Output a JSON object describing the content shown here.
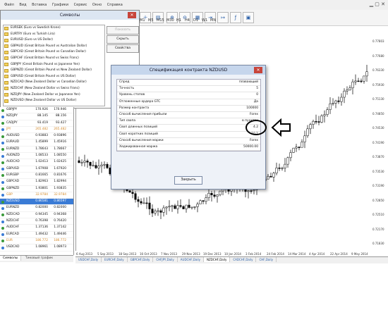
{
  "menubar": {
    "items": [
      "Файл",
      "Вид",
      "Вставка",
      "Графики",
      "Сервис",
      "Окно",
      "Справка"
    ]
  },
  "toolbar": {
    "timeframes": [
      "M1",
      "M5",
      "M15",
      "M30",
      "H1",
      "H4",
      "D1",
      "W1",
      "MN"
    ]
  },
  "symbols_window": {
    "title": "Символы",
    "items": [
      "EURSEK (Euro vs Swedish Krone)",
      "EURTRY (Euro vs Turkish Lira)",
      "EURUSD (Euro vs US Dollar)",
      "GBPAUD (Great Britain Pound vs Australian Dollar)",
      "GBPCAD (Great Britain Pound vs Canadian Dollar)",
      "GBPCHF (Great Britain Pound vs Swiss Franc)",
      "GBPJPY (Great Britain Pound vs Japanese Yen)",
      "GBPNZD (Great Britain Pound vs New Zealand Dollar)",
      "GBPUSD (Great Britain Pound vs US Dollar)",
      "NZDCAD (New Zealand Dollar vs Canadian Dollar)",
      "NZDCHF (New Zealand Dollar vs Swiss Franc)",
      "NZDJPY (New Zealand Dollar vs Japanese Yen)",
      "NZDUSD (New Zealand Dollar vs US Dollar)"
    ],
    "buttons": {
      "show": "Показать",
      "hide": "Скрыть",
      "properties": "Свойства"
    }
  },
  "market_watch": {
    "rows": [
      {
        "symbol": "GBPJPY",
        "bid": "170.926",
        "ask": "170.946",
        "style": "normal"
      },
      {
        "symbol": "NZDJPY",
        "bid": "88.145",
        "ask": "88.156",
        "style": "normal"
      },
      {
        "symbol": "CADJPY",
        "bid": "93.419",
        "ask": "93.427",
        "style": "normal"
      },
      {
        "symbol": "JPY",
        "bid": "265.482",
        "ask": "265.482",
        "style": "faded"
      },
      {
        "symbol": "AUDUSD",
        "bid": "0.93883",
        "ask": "0.93896",
        "style": "normal"
      },
      {
        "symbol": "EURAUD",
        "bid": "1.45899",
        "ask": "1.45916",
        "style": "normal"
      },
      {
        "symbol": "EURNZD",
        "bid": "1.78643",
        "ask": "1.78667",
        "style": "normal"
      },
      {
        "symbol": "AUDNZD",
        "bid": "1.08533",
        "ask": "1.08550",
        "style": "normal"
      },
      {
        "symbol": "AUDCAD",
        "bid": "1.02413",
        "ask": "1.02425",
        "style": "normal"
      },
      {
        "symbol": "GBPUSD",
        "bid": "1.67908",
        "ask": "1.67920",
        "style": "normal"
      },
      {
        "symbol": "EURGBP",
        "bid": "0.81665",
        "ask": "0.81676",
        "style": "normal"
      },
      {
        "symbol": "GBPCAD",
        "bid": "1.82963",
        "ask": "1.82994",
        "style": "normal"
      },
      {
        "symbol": "GBPNZD",
        "bid": "1.93801",
        "ask": "1.93835",
        "style": "normal"
      },
      {
        "symbol": "GBP",
        "bid": "32.9784",
        "ask": "32.9784",
        "style": "faded"
      },
      {
        "symbol": "NZDUSD",
        "bid": "0.86581",
        "ask": "0.86597",
        "style": "selected"
      },
      {
        "symbol": "EURNZD",
        "bid": "0.82000",
        "ask": "0.82000",
        "style": "normal"
      },
      {
        "symbol": "NZDCAD",
        "bid": "0.94345",
        "ask": "0.94368",
        "style": "normal"
      },
      {
        "symbol": "NZDCHF",
        "bid": "0.76398",
        "ask": "0.76420",
        "style": "normal"
      },
      {
        "symbol": "AUDCHF",
        "bid": "1.37136",
        "ask": "1.37142",
        "style": "normal"
      },
      {
        "symbol": "EURCAD",
        "bid": "1.49432",
        "ask": "1.49446",
        "style": "normal"
      },
      {
        "symbol": "EUR",
        "bid": "186.772",
        "ask": "186.772",
        "style": "faded"
      },
      {
        "symbol": "USDCAD",
        "bid": "1.08961",
        "ask": "1.08973",
        "style": "normal"
      }
    ],
    "tabs": [
      "Символы",
      "Тиковый график"
    ]
  },
  "modal": {
    "title": "Спецификация контракта NZDUSD",
    "rows": [
      {
        "key": "Спред",
        "value": "плавающий"
      },
      {
        "key": "Точность",
        "value": "5"
      },
      {
        "key": "Уровень стопов",
        "value": "0"
      },
      {
        "key": "Отложенные ордера GTC",
        "value": "Да"
      },
      {
        "key": "Размер контракта",
        "value": "100000"
      },
      {
        "key": "Способ вычисления прибыли",
        "value": "Forex"
      },
      {
        "key": "Тип свопа",
        "value": "в пунктах"
      },
      {
        "key": "Своп длинных позиций",
        "value": "4.2"
      },
      {
        "key": "Своп коротких позиций",
        "value": "-10.1"
      },
      {
        "key": "Способ вычисления маржи",
        "value": "Forex"
      },
      {
        "key": "Хеджированная маржа",
        "value": "50000.00"
      }
    ],
    "close_label": "Закрыть"
  },
  "chart": {
    "price_labels": [
      "0.77803",
      "0.77680",
      "0.76330",
      "0.75930",
      "0.75130",
      "0.74850",
      "0.74530",
      "0.74190",
      "0.73870",
      "0.73530",
      "0.73190",
      "0.72850",
      "0.72510",
      "0.72170",
      "0.71830"
    ],
    "date_labels": [
      "6 Aug 2013",
      "5 Sep 2013",
      "18 Sep 2013",
      "16 Oct 2013",
      "7 Nov 2013",
      "29 Nov 2013",
      "19 Dec 2013",
      "10 Jan 2014",
      "3 Feb 2014",
      "24 Feb 2014",
      "14 Mar 2014",
      "4 Apr 2014",
      "22 Apr 2014",
      "9 May 2014"
    ],
    "tabs": [
      "USDCHF,Daily",
      "EURCHF,Daily",
      "GBPCHF,Daily",
      "CHFJPY,Daily",
      "AUDCHF,Daily",
      "NZDCHF,Daily",
      "CADCHF,Daily",
      "CHF,Daily"
    ],
    "active_tab": "NZDCHF,Daily"
  },
  "colors": {
    "accent": "#3a7bd5",
    "close_red": "#c7443a",
    "dialog_bg": "#eef2f8"
  }
}
